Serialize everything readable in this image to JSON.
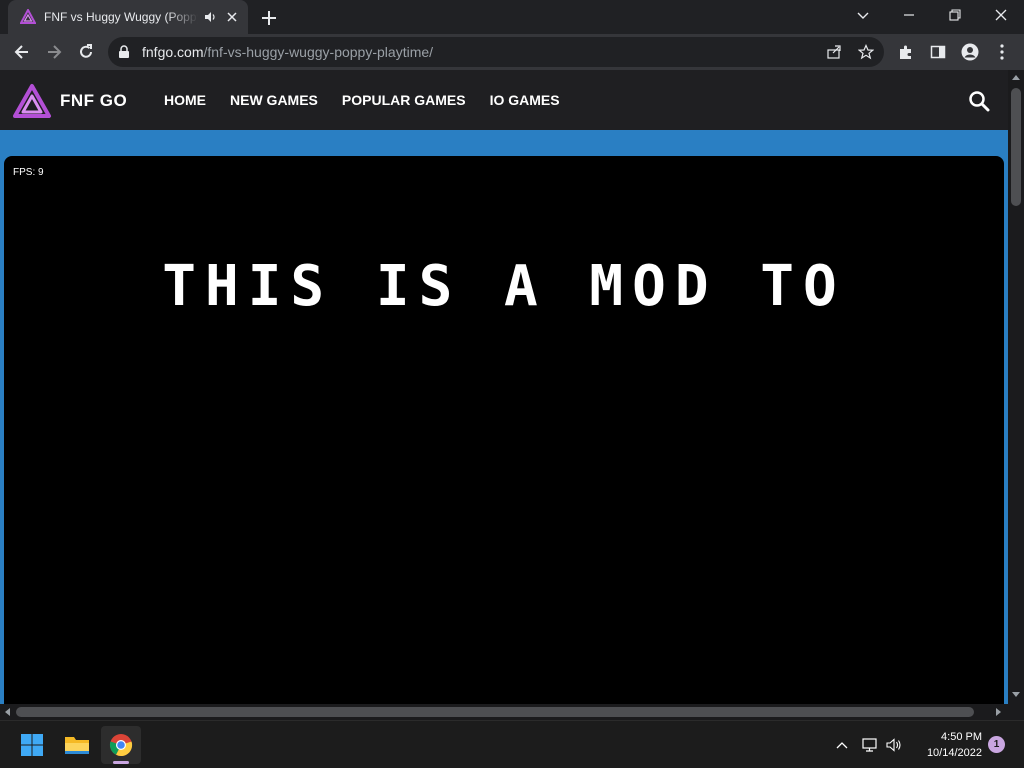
{
  "browser": {
    "tab": {
      "title": "FNF vs Huggy Wuggy (Poppy Playtime)",
      "audio_icon": "speaker-icon",
      "close_icon": "close-icon"
    },
    "window_controls": [
      "chevron-down-icon",
      "minimize-icon",
      "restore-icon",
      "close-icon"
    ],
    "address": {
      "host": "fnfgo.com",
      "path": "/fnf-vs-huggy-wuggy-poppy-playtime/"
    }
  },
  "site": {
    "logo_text": "FNF GO",
    "nav": [
      "HOME",
      "NEW GAMES",
      "POPULAR GAMES",
      "IO GAMES"
    ],
    "colors": {
      "accent": "#2a7fc3",
      "header": "#1f1f22",
      "logo": "#b34fd6"
    }
  },
  "game": {
    "fps_label": "FPS: 9",
    "message": "THIS IS A MOD TO"
  },
  "taskbar": {
    "apps": [
      "windows-start-icon",
      "file-explorer-icon",
      "chrome-icon"
    ],
    "clock": {
      "time": "4:50 PM",
      "date": "10/14/2022"
    },
    "notification_count": "1"
  }
}
